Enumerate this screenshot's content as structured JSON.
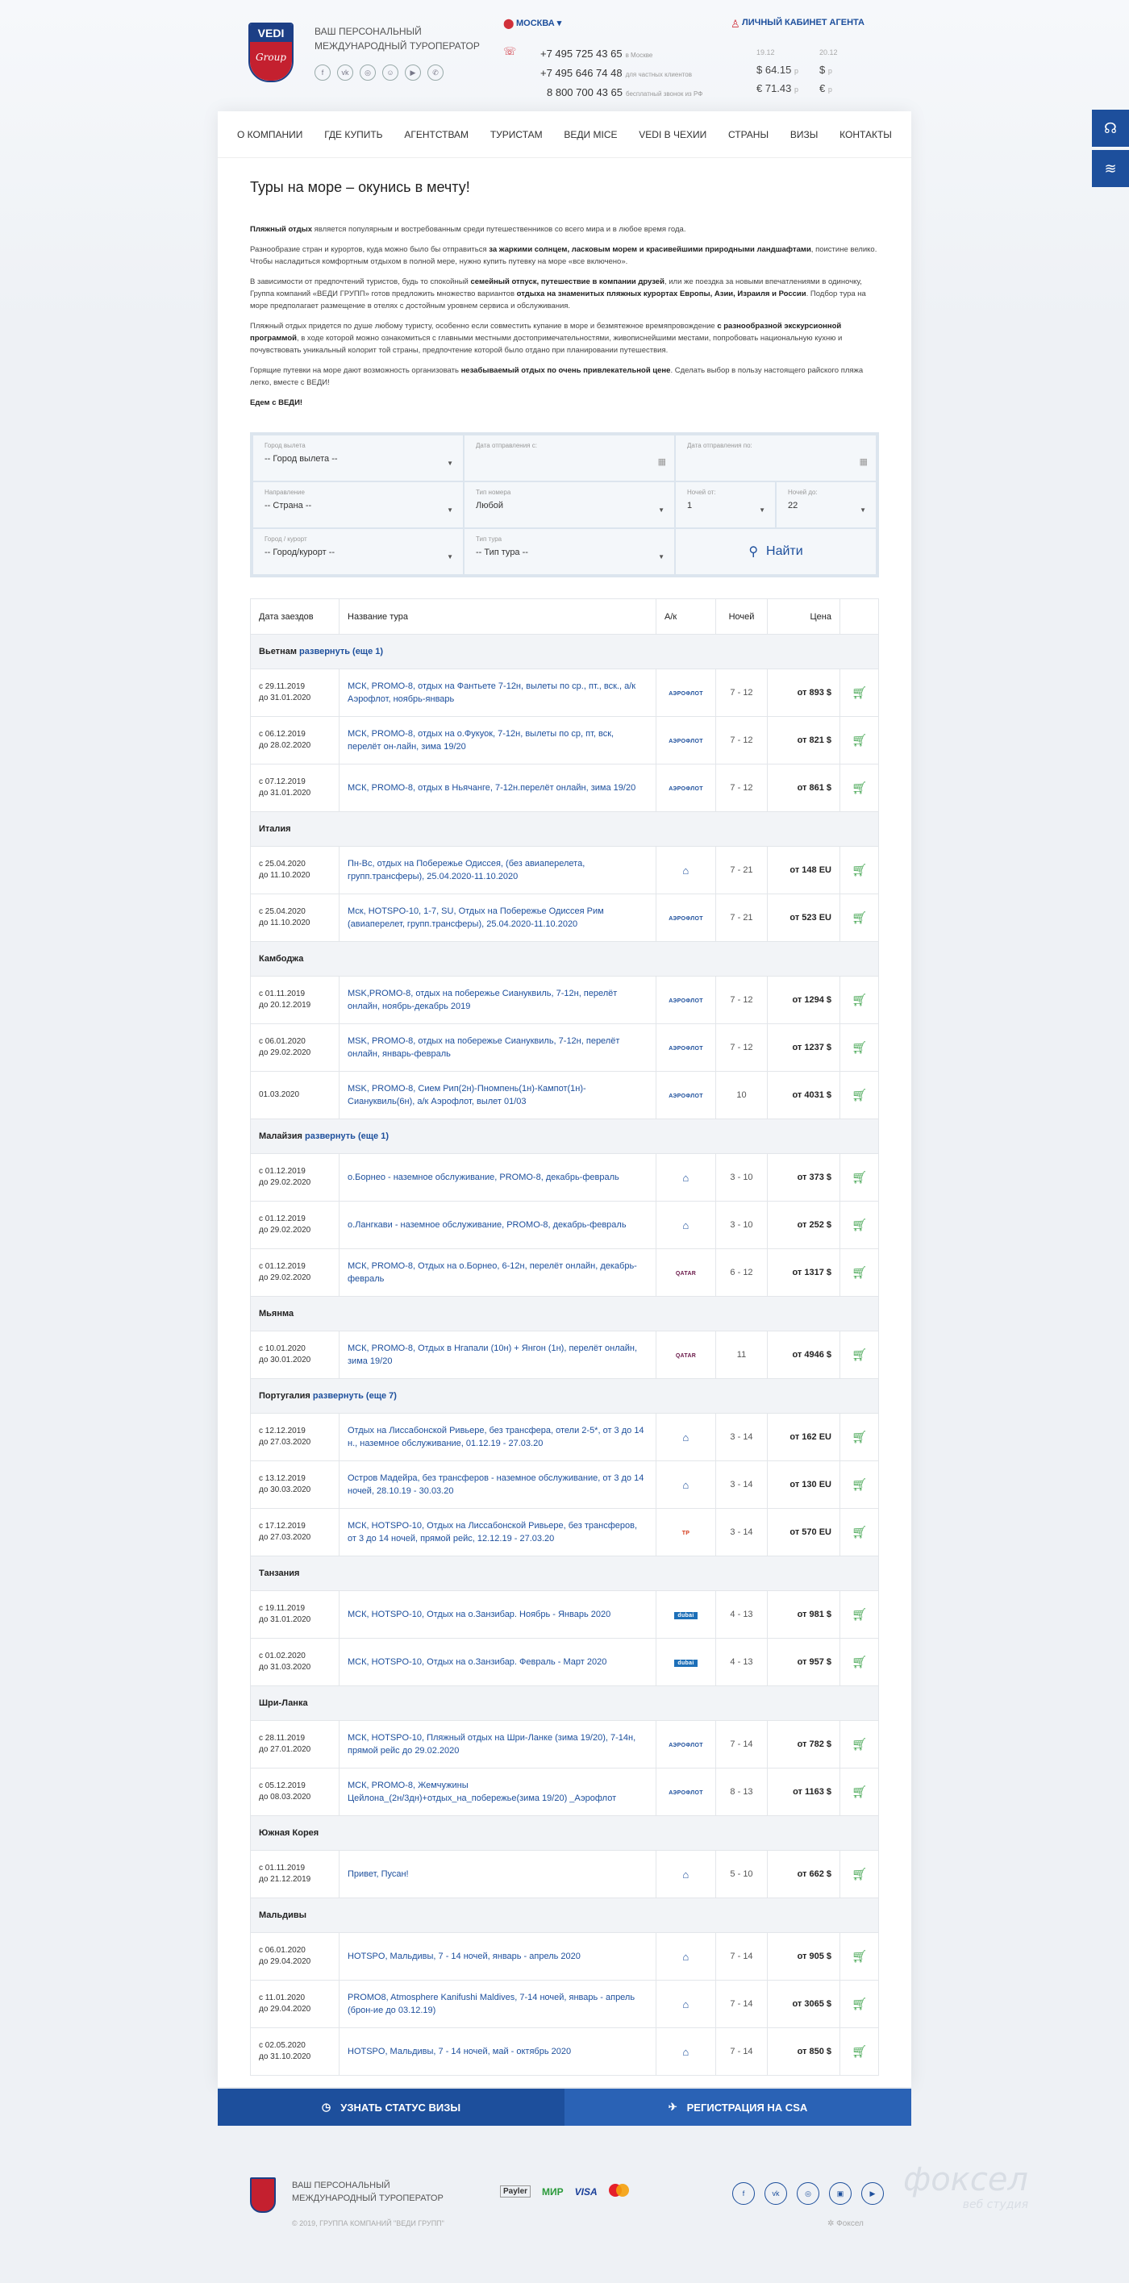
{
  "header": {
    "tagline1": "ВАШ ПЕРСОНАЛЬНЫЙ",
    "tagline2": "МЕЖДУНАРОДНЫЙ ТУРОПЕРАТОР",
    "logo_top": "VEDI",
    "logo_bottom": "Group",
    "city": "МОСКВА",
    "cabinet": "ЛИЧНЫЙ КАБИНЕТ АГЕНТА",
    "phones": [
      {
        "n": "+7 495 725 43 65",
        "note": "в Москве"
      },
      {
        "n": "+7 495 646 74 48",
        "note": "для частных клиентов"
      },
      {
        "n": "8 800 700 43 65",
        "note": "бесплатный звонок из РФ"
      }
    ],
    "rates": {
      "d1": "19.12",
      "d2": "20.12",
      "usd1": "$ 64.15",
      "usd1u": "р",
      "usd2": "$",
      "usd2u": "р",
      "eur1": "€ 71.43",
      "eur1u": "р",
      "eur2": "€",
      "eur2u": "р"
    }
  },
  "nav": [
    "О КОМПАНИИ",
    "ГДЕ КУПИТЬ",
    "АГЕНТСТВАМ",
    "ТУРИСТАМ",
    "ВЕДИ MICE",
    "VEDI В ЧЕХИИ",
    "СТРАНЫ",
    "ВИЗЫ",
    "КОНТАКТЫ"
  ],
  "content": {
    "title": "Туры на море – окунись в мечту!",
    "p1a": "Пляжный отдых",
    "p1b": " является популярным и востребованным среди путешественников со всего мира и в любое время года.",
    "p2a": "Разнообразие стран и курортов, куда можно было бы отправиться ",
    "p2b": "за жаркими солнцем, ласковым морем и красивейшими природными ландшафтами",
    "p2c": ", поистине велико. Чтобы насладиться комфортным отдыхом в полной мере, нужно купить путевку на море «все включено».",
    "p3a": "В зависимости от предпочтений туристов, будь то спокойный ",
    "p3b": "семейный отпуск, путешествие в компании друзей",
    "p3c": ", или же поездка за новыми впечатлениями в одиночку, Группа компаний «ВЕДИ ГРУПП» готов предложить множество вариантов ",
    "p3d": "отдыха на знаменитых пляжных курортах Европы, Азии, Израиля и России",
    "p3e": ". Подбор тура на море предполагает размещение в отелях с достойным уровнем сервиса и обслуживания.",
    "p4a": "Пляжный отдых придется по душе любому туристу, особенно если совместить купание в море и безмятежное времяпровождение ",
    "p4b": "с разнообразной экскурсионной программой",
    "p4c": ", в ходе которой можно ознакомиться с главными местными достопримечательностями, живописнейшими местами, попробовать национальную кухню и почувствовать уникальный колорит той страны, предпочтение которой было отдано при планировании путешествия.",
    "p5a": "Горящие путевки на море дают возможность организовать ",
    "p5b": "незабываемый отдых по очень привлекательной цене",
    "p5c": ". Сделать выбор в пользу настоящего райского пляжа легко, вместе с ВЕДИ!",
    "p6": "Едем с ВЕДИ!"
  },
  "search": {
    "city_l": "Город вылета",
    "city_v": "-- Город вылета --",
    "from_l": "Дата отправления с:",
    "to_l": "Дата отправления по:",
    "dir_l": "Направление",
    "dir_v": "-- Страна --",
    "room_l": "Тип номера",
    "room_v": "Любой",
    "nfrom_l": "Ночей от:",
    "nfrom_v": "1",
    "nto_l": "Ночей до:",
    "nto_v": "22",
    "resort_l": "Город / курорт",
    "resort_v": "-- Город/курорт --",
    "type_l": "Тип тура",
    "type_v": "-- Тип тура --",
    "find": "Найти"
  },
  "table": {
    "h": [
      "Дата заездов",
      "Название тура",
      "А/к",
      "Ночей",
      "Цена"
    ],
    "groups": [
      {
        "c": "Вьетнам",
        "more": "развернуть (еще 1)",
        "rows": [
          {
            "d1": "с 29.11.2019",
            "d2": "до 31.01.2020",
            "n": "МСК, PROMO-8, отдых на Фантьете 7-12н, вылеты по ср., пт., вск., а/к Аэрофлот, ноябрь-январь",
            "a": "АЭРОФЛОТ",
            "at": "af",
            "ni": "7 - 12",
            "p": "от 893 $"
          },
          {
            "d1": "с 06.12.2019",
            "d2": "до 28.02.2020",
            "n": "МСК, PROMO-8, отдых на о.Фукуок, 7-12н, вылеты по ср, пт, вск, перелёт он-лайн, зима 19/20",
            "a": "АЭРОФЛОТ",
            "at": "af",
            "ni": "7 - 12",
            "p": "от 821 $"
          },
          {
            "d1": "с 07.12.2019",
            "d2": "до 31.01.2020",
            "n": "МСК, PROMO-8, отдых в Ньячанге, 7-12н.перелёт онлайн, зима 19/20",
            "a": "АЭРОФЛОТ",
            "at": "af",
            "ni": "7 - 12",
            "p": "от 861 $"
          }
        ]
      },
      {
        "c": "Италия",
        "more": "",
        "rows": [
          {
            "d1": "с 25.04.2020",
            "d2": "до 11.10.2020",
            "n": "Пн-Вс, отдых на Побережье Одиссея, (без авиаперелета, групп.трансферы), 25.04.2020-11.10.2020",
            "a": "⌂",
            "at": "home",
            "ni": "7 - 21",
            "p": "от 148 EU"
          },
          {
            "d1": "с 25.04.2020",
            "d2": "до 11.10.2020",
            "n": "Мск, HOTSPO-10, 1-7, SU, Отдых на Побережье Одиссея Рим (авиаперелет, групп.трансферы), 25.04.2020-11.10.2020",
            "a": "АЭРОФЛОТ",
            "at": "af",
            "ni": "7 - 21",
            "p": "от 523 EU"
          }
        ]
      },
      {
        "c": "Камбоджа",
        "more": "",
        "rows": [
          {
            "d1": "с 01.11.2019",
            "d2": "до 20.12.2019",
            "n": "MSK,PROMO-8, отдых на побережье Сиануквиль, 7-12н, перелёт онлайн, ноябрь-декабрь 2019",
            "a": "АЭРОФЛОТ",
            "at": "af",
            "ni": "7 - 12",
            "p": "от 1294 $"
          },
          {
            "d1": "с 06.01.2020",
            "d2": "до 29.02.2020",
            "n": "MSK, PROMO-8, отдых на побережье Сиануквиль, 7-12н, перелёт онлайн, январь-февраль",
            "a": "АЭРОФЛОТ",
            "at": "af",
            "ni": "7 - 12",
            "p": "от 1237 $"
          },
          {
            "d1": "01.03.2020",
            "d2": "",
            "n": "MSK, PROMO-8, Сием Рип(2н)-Пномпень(1н)-Кампот(1н)-Сиануквиль(6н), а/к Аэрофлот, вылет 01/03",
            "a": "АЭРОФЛОТ",
            "at": "af",
            "ni": "10",
            "p": "от 4031 $"
          }
        ]
      },
      {
        "c": "Малайзия",
        "more": "развернуть (еще 1)",
        "rows": [
          {
            "d1": "с 01.12.2019",
            "d2": "до 29.02.2020",
            "n": "о.Борнео - наземное обслуживание, PROMO-8, декабрь-февраль",
            "a": "⌂",
            "at": "home",
            "ni": "3 - 10",
            "p": "от 373 $"
          },
          {
            "d1": "с 01.12.2019",
            "d2": "до 29.02.2020",
            "n": "о.Лангкави - наземное обслуживание, PROMO-8, декабрь-февраль",
            "a": "⌂",
            "at": "home",
            "ni": "3 - 10",
            "p": "от 252 $"
          },
          {
            "d1": "с 01.12.2019",
            "d2": "до 29.02.2020",
            "n": "МСК, PROMO-8, Отдых на о.Борнео, 6-12н, перелёт онлайн, декабрь-февраль",
            "a": "QATAR",
            "at": "qt",
            "ni": "6 - 12",
            "p": "от 1317 $"
          }
        ]
      },
      {
        "c": "Мьянма",
        "more": "",
        "rows": [
          {
            "d1": "с 10.01.2020",
            "d2": "до 30.01.2020",
            "n": "МСК, PROMO-8, Отдых в Нгапали (10н) + Янгон (1н), перелёт онлайн, зима 19/20",
            "a": "QATAR",
            "at": "qt",
            "ni": "11",
            "p": "от 4946 $"
          }
        ]
      },
      {
        "c": "Португалия",
        "more": "развернуть (еще 7)",
        "rows": [
          {
            "d1": "с 12.12.2019",
            "d2": "до 27.03.2020",
            "n": "Отдых на Лиссабонской Ривьере, без трансфера, отели 2-5*, от 3 до 14 н., наземное обслуживание, 01.12.19 - 27.03.20",
            "a": "⌂",
            "at": "home",
            "ni": "3 - 14",
            "p": "от 162 EU"
          },
          {
            "d1": "с 13.12.2019",
            "d2": "до 30.03.2020",
            "n": "Остров Мадейра, без трансферов - наземное обслуживание, от 3 до 14 ночей, 28.10.19 - 30.03.20",
            "a": "⌂",
            "at": "home",
            "ni": "3 - 14",
            "p": "от 130 EU"
          },
          {
            "d1": "с 17.12.2019",
            "d2": "до 27.03.2020",
            "n": "МСК, HOTSPO-10, Отдых на Лиссабонской Ривьере, без трансферов, от 3 до 14 ночей, прямой рейс, 12.12.19 - 27.03.20",
            "a": "TP",
            "at": "tp",
            "ni": "3 - 14",
            "p": "от 570 EU"
          }
        ]
      },
      {
        "c": "Танзания",
        "more": "",
        "rows": [
          {
            "d1": "с 19.11.2019",
            "d2": "до 31.01.2020",
            "n": "МСК, HOTSPO-10, Отдых на о.Занзибар. Ноябрь - Январь 2020",
            "a": "dubai",
            "at": "dub",
            "ni": "4 - 13",
            "p": "от 981 $"
          },
          {
            "d1": "с 01.02.2020",
            "d2": "до 31.03.2020",
            "n": "МСК, HOTSPO-10, Отдых на о.Занзибар. Февраль - Март 2020",
            "a": "dubai",
            "at": "dub",
            "ni": "4 - 13",
            "p": "от 957 $"
          }
        ]
      },
      {
        "c": "Шри-Ланка",
        "more": "",
        "rows": [
          {
            "d1": "с 28.11.2019",
            "d2": "до 27.01.2020",
            "n": "МСК, HOTSPO-10, Пляжный отдых на Шри-Ланке (зима 19/20), 7-14н, прямой рейс до 29.02.2020",
            "a": "АЭРОФЛОТ",
            "at": "af",
            "ni": "7 - 14",
            "p": "от 782 $"
          },
          {
            "d1": "с 05.12.2019",
            "d2": "до 08.03.2020",
            "n": "МСК, PROMO-8, Жемчужины Цейлона_(2н/3дн)+отдых_на_побережье(зима 19/20) _Аэрофлот",
            "a": "АЭРОФЛОТ",
            "at": "af",
            "ni": "8 - 13",
            "p": "от 1163 $"
          }
        ]
      },
      {
        "c": "Южная Корея",
        "more": "",
        "rows": [
          {
            "d1": "с 01.11.2019",
            "d2": "до 21.12.2019",
            "n": "Привет, Пусан!",
            "a": "⌂",
            "at": "home",
            "ni": "5 - 10",
            "p": "от 662 $"
          }
        ]
      },
      {
        "c": "Мальдивы",
        "more": "",
        "rows": [
          {
            "d1": "с 06.01.2020",
            "d2": "до 29.04.2020",
            "n": "HOTSPO, Мальдивы, 7 - 14 ночей, январь - апрель 2020",
            "a": "⌂",
            "at": "home",
            "ni": "7 - 14",
            "p": "от 905 $"
          },
          {
            "d1": "с 11.01.2020",
            "d2": "до 29.04.2020",
            "n": "PROMO8, Atmosphere Kanifushi Maldives, 7-14 ночей, январь - апрель (брон-ие до 03.12.19)",
            "a": "⌂",
            "at": "home",
            "ni": "7 - 14",
            "p": "от 3065 $"
          },
          {
            "d1": "с 02.05.2020",
            "d2": "до 31.10.2020",
            "n": "HOTSPO, Мальдивы, 7 - 14 ночей, май - октябрь 2020",
            "a": "⌂",
            "at": "home",
            "ni": "7 - 14",
            "p": "от 850 $"
          }
        ]
      }
    ]
  },
  "bottom": {
    "visa": "УЗНАТЬ СТАТУС ВИЗЫ",
    "csa": "РЕГИСТРАЦИЯ НА CSA"
  },
  "footer": {
    "t1": "ВАШ ПЕРСОНАЛЬНЫЙ",
    "t2": "МЕЖДУНАРОДНЫЙ ТУРОПЕРАТОР",
    "copy": "© 2019, ГРУППА КОМПАНИЙ \"ВЕДИ ГРУПП\"",
    "pay": [
      "Payler",
      "МИР",
      "VISA"
    ],
    "foxel": "фоксел",
    "foxel_sub": "веб студия",
    "foxel_small": "Фоксел"
  },
  "colors": {
    "brand": "#1d4f9c",
    "red": "#c4202f",
    "cart": "#3fa34d"
  }
}
